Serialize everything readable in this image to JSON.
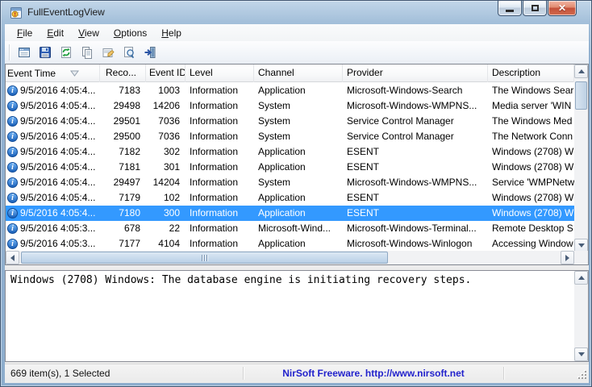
{
  "window": {
    "title": "FullEventLogView",
    "controls": {
      "minimize": "minimize",
      "maximize": "maximize",
      "close": "close"
    }
  },
  "menu": {
    "items": [
      {
        "label": "File"
      },
      {
        "label": "Edit"
      },
      {
        "label": "View"
      },
      {
        "label": "Options"
      },
      {
        "label": "Help"
      }
    ]
  },
  "toolbar": {
    "buttons": [
      "choose-data-source",
      "save",
      "refresh",
      "copy",
      "properties",
      "find",
      "exit"
    ]
  },
  "table": {
    "columns": [
      {
        "label": "Event Time",
        "sort": "desc"
      },
      {
        "label": "Reco..."
      },
      {
        "label": "Event ID"
      },
      {
        "label": "Level"
      },
      {
        "label": "Channel"
      },
      {
        "label": "Provider"
      },
      {
        "label": "Description"
      }
    ],
    "rows": [
      {
        "time": "9/5/2016 4:05:4...",
        "record": "7183",
        "event_id": "1003",
        "level": "Information",
        "channel": "Application",
        "provider": "Microsoft-Windows-Search",
        "description": "The Windows Sear",
        "selected": false
      },
      {
        "time": "9/5/2016 4:05:4...",
        "record": "29498",
        "event_id": "14206",
        "level": "Information",
        "channel": "System",
        "provider": "Microsoft-Windows-WMPNS...",
        "description": "Media server 'WIN",
        "selected": false
      },
      {
        "time": "9/5/2016 4:05:4...",
        "record": "29501",
        "event_id": "7036",
        "level": "Information",
        "channel": "System",
        "provider": "Service Control Manager",
        "description": "The Windows Med",
        "selected": false
      },
      {
        "time": "9/5/2016 4:05:4...",
        "record": "29500",
        "event_id": "7036",
        "level": "Information",
        "channel": "System",
        "provider": "Service Control Manager",
        "description": "The Network Conn",
        "selected": false
      },
      {
        "time": "9/5/2016 4:05:4...",
        "record": "7182",
        "event_id": "302",
        "level": "Information",
        "channel": "Application",
        "provider": "ESENT",
        "description": "Windows (2708) W",
        "selected": false
      },
      {
        "time": "9/5/2016 4:05:4...",
        "record": "7181",
        "event_id": "301",
        "level": "Information",
        "channel": "Application",
        "provider": "ESENT",
        "description": "Windows (2708) W",
        "selected": false
      },
      {
        "time": "9/5/2016 4:05:4...",
        "record": "29497",
        "event_id": "14204",
        "level": "Information",
        "channel": "System",
        "provider": "Microsoft-Windows-WMPNS...",
        "description": "Service 'WMPNetw",
        "selected": false
      },
      {
        "time": "9/5/2016 4:05:4...",
        "record": "7179",
        "event_id": "102",
        "level": "Information",
        "channel": "Application",
        "provider": "ESENT",
        "description": "Windows (2708) W",
        "selected": false
      },
      {
        "time": "9/5/2016 4:05:4...",
        "record": "7180",
        "event_id": "300",
        "level": "Information",
        "channel": "Application",
        "provider": "ESENT",
        "description": "Windows (2708) W",
        "selected": true
      },
      {
        "time": "9/5/2016 4:05:3...",
        "record": "678",
        "event_id": "22",
        "level": "Information",
        "channel": "Microsoft-Wind...",
        "provider": "Microsoft-Windows-Terminal...",
        "description": "Remote Desktop S",
        "selected": false
      },
      {
        "time": "9/5/2016 4:05:3...",
        "record": "7177",
        "event_id": "4104",
        "level": "Information",
        "channel": "Application",
        "provider": "Microsoft-Windows-Winlogon",
        "description": "Accessing Window",
        "selected": false
      }
    ]
  },
  "detail": {
    "text": "Windows (2708) Windows: The database engine is initiating recovery steps."
  },
  "status": {
    "items_text": "669 item(s), 1 Selected",
    "branding": "NirSoft Freeware.  http://www.nirsoft.net"
  },
  "colors": {
    "selection": "#3399ff",
    "branding_text": "#2222cc",
    "titlebar": "#9fbcd7"
  }
}
